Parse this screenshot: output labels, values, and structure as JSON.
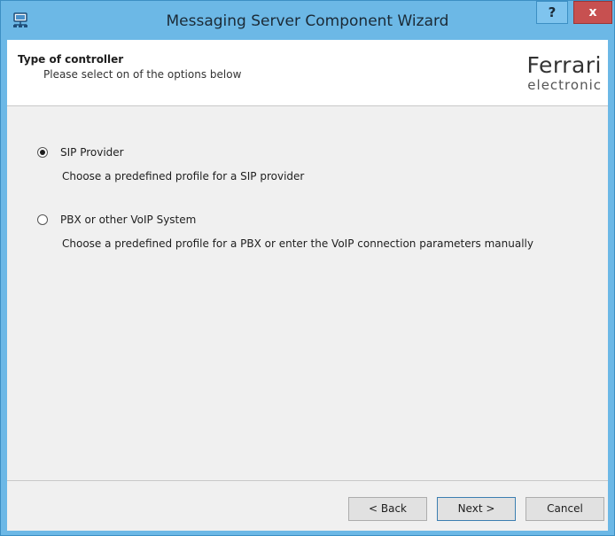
{
  "window": {
    "title": "Messaging Server Component Wizard",
    "help_label": "?",
    "close_label": "x"
  },
  "header": {
    "title": "Type of controller",
    "subtitle": "Please select on of the options below",
    "logo_top": "Ferrari",
    "logo_bottom": "electronic"
  },
  "options": [
    {
      "label": "SIP Provider",
      "description": "Choose a predefined profile for a SIP provider",
      "selected": true
    },
    {
      "label": "PBX or other VoIP System",
      "description": "Choose a predefined profile for a PBX or enter the VoIP connection parameters manually",
      "selected": false
    }
  ],
  "buttons": {
    "back": "< Back",
    "next": "Next >",
    "cancel": "Cancel"
  },
  "colors": {
    "titlebar": "#6cb8e6",
    "close": "#c75050",
    "panel": "#f0f0f0"
  }
}
